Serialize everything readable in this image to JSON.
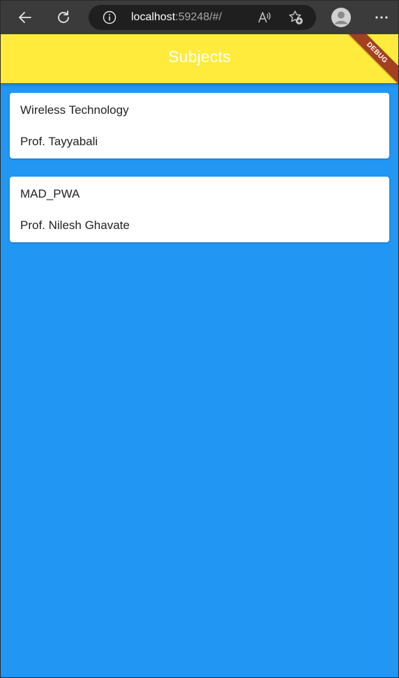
{
  "browser": {
    "url_host": "localhost",
    "url_rest": ":59248/#/",
    "icons": {
      "back": "back-arrow-icon",
      "refresh": "refresh-icon",
      "info": "info-icon",
      "read_aloud": "read-aloud-icon",
      "favorite": "add-favorite-icon",
      "profile": "profile-avatar-icon",
      "more": "more-options-icon"
    }
  },
  "app": {
    "title": "Subjects",
    "debug_label": "DEBUG",
    "colors": {
      "appbar": "#ffeb3b",
      "background": "#2196f3",
      "debug": "#a3401f"
    },
    "subjects": [
      {
        "name": "Wireless Technology",
        "teacher": "Prof. Tayyabali"
      },
      {
        "name": "MAD_PWA",
        "teacher": "Prof. Nilesh Ghavate"
      }
    ]
  }
}
